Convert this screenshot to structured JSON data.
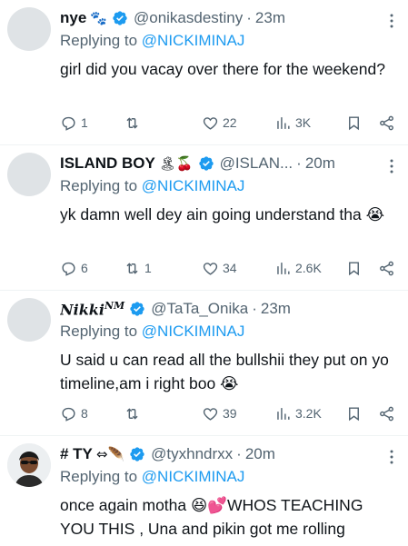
{
  "tweets": [
    {
      "name": "nye",
      "name_emoji": "🐾",
      "handle": "@onikasdestiny",
      "separator": "·",
      "time": "23m",
      "replying_prefix": "Replying to ",
      "replying_to": "@NICKIMINAJ",
      "text": "girl did you vacay over there for the weekend?",
      "replies": "1",
      "retweets": "",
      "likes": "22",
      "views": "3K"
    },
    {
      "name": "ISLAND BOY",
      "name_emoji": "🏝🍒",
      "handle": "@ISLAN...",
      "separator": "·",
      "time": "20m",
      "replying_prefix": "Replying to ",
      "replying_to": "@NICKIMINAJ",
      "text": "yk damn well dey ain going understand tha 😭",
      "replies": "6",
      "retweets": "1",
      "likes": "34",
      "views": "2.6K"
    },
    {
      "name": "Nikki",
      "name_sup": "NM",
      "handle": "@TaTa_Onika",
      "separator": "·",
      "time": "23m",
      "replying_prefix": "Replying to ",
      "replying_to": "@NICKIMINAJ",
      "text": "U said u can read all the bullshii they put on yo timeline,am i right boo 😭",
      "replies": "8",
      "retweets": "",
      "likes": "39",
      "views": "3.2K"
    },
    {
      "name": "# TY",
      "name_emoji": "⇔🪶",
      "handle": "@tyxhndrxx",
      "separator": "·",
      "time": "20m",
      "replying_prefix": "Replying to ",
      "replying_to": "@NICKIMINAJ",
      "text": "once again motha 😆💕WHOS TEACHING YOU THIS , Una and pikin got me rolling",
      "replies": "",
      "retweets": "",
      "likes": "",
      "views": ""
    }
  ],
  "colors": {
    "text": "#0f1419",
    "secondary": "#536471",
    "link": "#1d9bf0",
    "divider": "#eff3f4",
    "verified": "#1d9bf0"
  }
}
